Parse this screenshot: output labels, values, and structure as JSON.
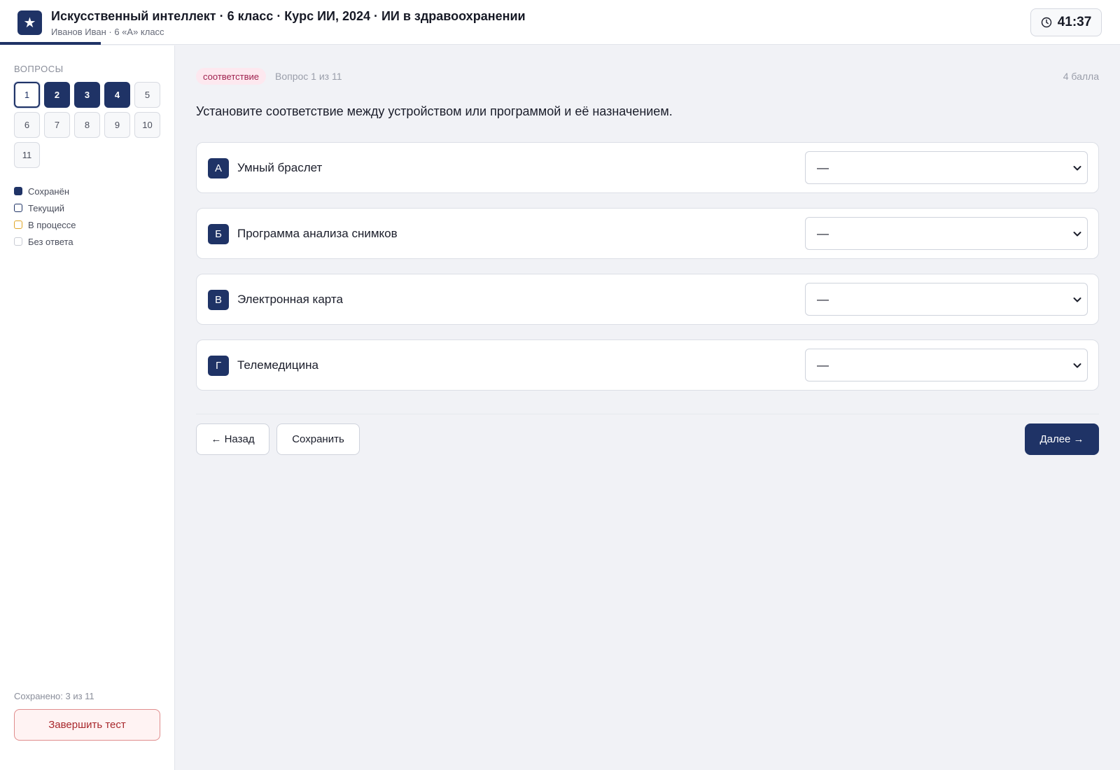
{
  "header": {
    "logo_glyph": "★",
    "title": "Искусственный интеллект · 6 класс · Курс ИИ, 2024 · ИИ в здравоохранении",
    "subtitle": "Иванов Иван · 6 «А» класс",
    "timer": {
      "icon": "clock-icon",
      "value": "41:37"
    }
  },
  "sidebar": {
    "heading": "Вопросы",
    "questions": [
      {
        "number": "1",
        "status": "current"
      },
      {
        "number": "2",
        "status": "saved"
      },
      {
        "number": "3",
        "status": "saved"
      },
      {
        "number": "4",
        "status": "saved"
      },
      {
        "number": "5",
        "status": "empty"
      },
      {
        "number": "6",
        "status": "empty"
      },
      {
        "number": "7",
        "status": "empty"
      },
      {
        "number": "8",
        "status": "empty"
      },
      {
        "number": "9",
        "status": "empty"
      },
      {
        "number": "10",
        "status": "empty"
      },
      {
        "number": "11",
        "status": "empty"
      }
    ],
    "legend": {
      "saved": "Сохранён",
      "current": "Текущий",
      "in_progress": "В процессе",
      "empty": "Без ответа"
    },
    "saved_count": "Сохранено: 3 из 11",
    "finish_button": "Завершить тест"
  },
  "question": {
    "type_badge": "соответствие",
    "counter": "Вопрос 1 из 11",
    "points": "4 балла",
    "text": "Установите соответствие между устройством или программой и её назначением.",
    "pairs": [
      {
        "letter": "А",
        "label": "Умный браслет",
        "selected": "—"
      },
      {
        "letter": "Б",
        "label": "Программа анализа снимков",
        "selected": "—"
      },
      {
        "letter": "В",
        "label": "Электронная карта",
        "selected": "—"
      },
      {
        "letter": "Г",
        "label": "Телемедицина",
        "selected": "—"
      }
    ]
  },
  "nav": {
    "back": "← Назад",
    "save": "Сохранить",
    "next": "Далее →"
  },
  "colors": {
    "primary": "#1f3366",
    "in_progress": "#e0a526",
    "badge_text": "#a02350",
    "badge_bg": "#fde8ef",
    "danger": "#a8282c"
  }
}
